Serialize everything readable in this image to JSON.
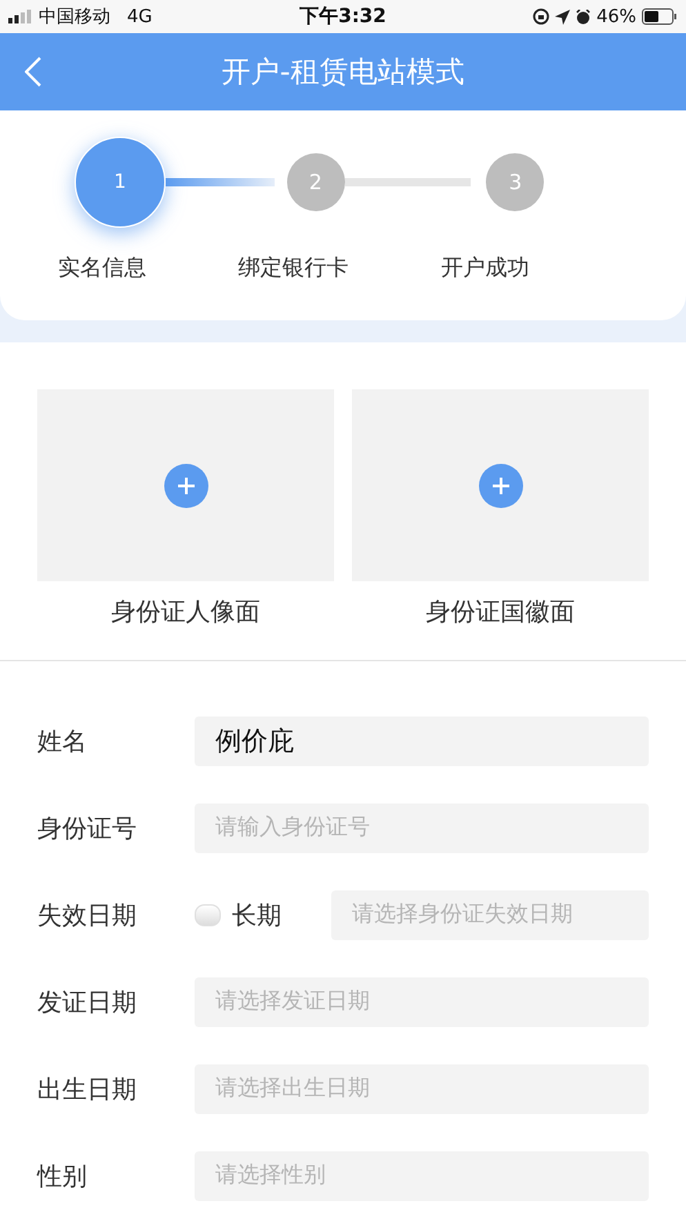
{
  "status_bar": {
    "carrier": "中国移动",
    "network": "4G",
    "time": "下午3:32",
    "battery": "46%"
  },
  "header": {
    "title": "开户-租赁电站模式"
  },
  "steps": [
    {
      "number": "1",
      "label": "实名信息",
      "active": true
    },
    {
      "number": "2",
      "label": "绑定银行卡",
      "active": false
    },
    {
      "number": "3",
      "label": "开户成功",
      "active": false
    }
  ],
  "uploads": [
    {
      "label": "身份证人像面"
    },
    {
      "label": "身份证国徽面"
    }
  ],
  "form": [
    {
      "kind": "input",
      "label": "姓名",
      "value": "例价庇"
    },
    {
      "kind": "input",
      "label": "身份证号",
      "placeholder": "请输入身份证号"
    },
    {
      "kind": "checkbox_date",
      "label": "失效日期",
      "option": "长期",
      "checked": false,
      "placeholder": "请选择身份证失效日期"
    },
    {
      "kind": "input",
      "label": "发证日期",
      "placeholder": "请选择发证日期"
    },
    {
      "kind": "input",
      "label": "出生日期",
      "placeholder": "请选择出生日期"
    },
    {
      "kind": "input",
      "label": "性别",
      "placeholder": "请选择性别"
    }
  ]
}
